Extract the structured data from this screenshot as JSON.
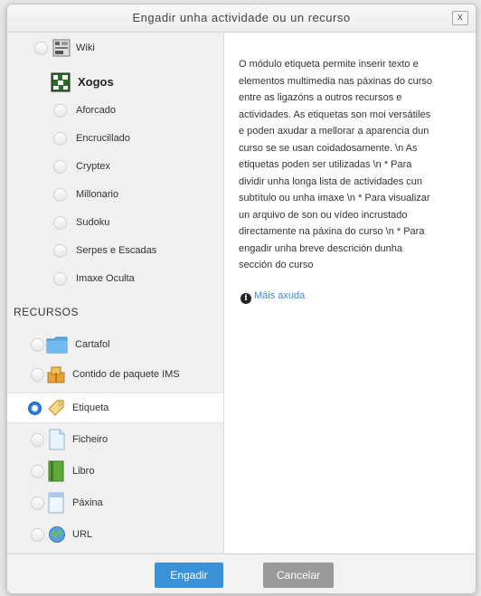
{
  "dialog": {
    "title": "Engadir unha actividade ou un recurso",
    "close_label": "x"
  },
  "activities": [
    {
      "label": "Wiki",
      "icon": "wiki-icon"
    },
    {
      "label": "Xogos",
      "icon": "games-icon"
    },
    {
      "label": "Aforcado",
      "icon": ""
    },
    {
      "label": "Encrucillado",
      "icon": ""
    },
    {
      "label": "Cryptex",
      "icon": ""
    },
    {
      "label": "Millonario",
      "icon": ""
    },
    {
      "label": "Sudoku",
      "icon": ""
    },
    {
      "label": "Serpes e Escadas",
      "icon": ""
    },
    {
      "label": "Imaxe Oculta",
      "icon": ""
    }
  ],
  "resources_heading": "RECURSOS",
  "resources": [
    {
      "label": "Cartafol",
      "icon": "folder-icon",
      "selected": false
    },
    {
      "label": "Contido de paquete IMS",
      "icon": "ims-package-icon",
      "selected": false
    },
    {
      "label": "Etiqueta",
      "icon": "label-tag-icon",
      "selected": true
    },
    {
      "label": "Ficheiro",
      "icon": "file-icon",
      "selected": false
    },
    {
      "label": "Libro",
      "icon": "book-icon",
      "selected": false
    },
    {
      "label": "Páxina",
      "icon": "page-icon",
      "selected": false
    },
    {
      "label": "URL",
      "icon": "url-globe-icon",
      "selected": false
    }
  ],
  "description": "O módulo etiqueta permite inserir texto e\nelementos multimedia nas páxinas do curso\nentre as ligazóns a outros recursos e\nactividades. As etiquetas son moi versátiles\ne poden axudar a mellorar a aparencia dun\ncurso se se usan coidadosamente. \\n As\netiquetas poden ser utilizadas \\n * Para\ndividir unha longa lista de actividades cun\nsubtítulo ou unha imaxe \\n * Para visualizar\nun arquivo de son ou vídeo incrustado\ndirectamente na páxina do curso \\n * Para\nengadir unha breve descrición dunha\nsección do curso",
  "help_link": "Máis axuda",
  "footer": {
    "add_label": "Engadir",
    "cancel_label": "Cancelar"
  },
  "colors": {
    "primary": "#3a91d6",
    "secondary": "#9a9a9a",
    "link": "#3a8bd8",
    "radio_selected": "#2a7ad8"
  }
}
